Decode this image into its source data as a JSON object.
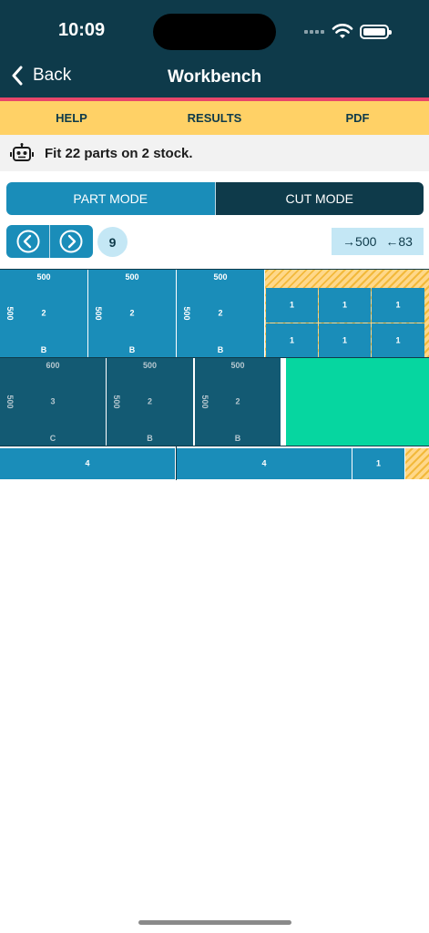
{
  "status": {
    "time": "10:09"
  },
  "nav": {
    "back_label": "Back",
    "title": "Workbench"
  },
  "tabs": [
    {
      "label": "HELP"
    },
    {
      "label": "RESULTS"
    },
    {
      "label": "PDF"
    }
  ],
  "info": {
    "message": "Fit 22 parts on 2 stock."
  },
  "modes": {
    "part_label": "PART MODE",
    "cut_label": "CUT MODE"
  },
  "pager": {
    "current_page": "9"
  },
  "dims": {
    "right": "500",
    "left": "83"
  },
  "colors": {
    "header": "#0e3a4a",
    "accent": "#ffd166",
    "part_blue": "#1a8db9",
    "part_dark": "#135a73",
    "part_green": "#06d6a0",
    "stripe": "#e8466a"
  },
  "layout": {
    "row1": [
      {
        "top": "500",
        "side": "500",
        "qty": "2",
        "code": "B"
      },
      {
        "top": "500",
        "side": "500",
        "qty": "2",
        "code": "B"
      },
      {
        "top": "500",
        "side": "500",
        "qty": "2",
        "code": "B"
      }
    ],
    "small_grid": [
      "1",
      "1",
      "1",
      "1",
      "1",
      "1"
    ],
    "row2": [
      {
        "top": "600",
        "side": "500",
        "qty": "3",
        "code": "C"
      },
      {
        "top": "500",
        "side": "500",
        "qty": "2",
        "code": "B"
      },
      {
        "top": "500",
        "side": "500",
        "qty": "2",
        "code": "B"
      }
    ],
    "row3": [
      {
        "qty": "4"
      },
      {
        "qty": "4"
      },
      {
        "qty": "1"
      }
    ]
  }
}
